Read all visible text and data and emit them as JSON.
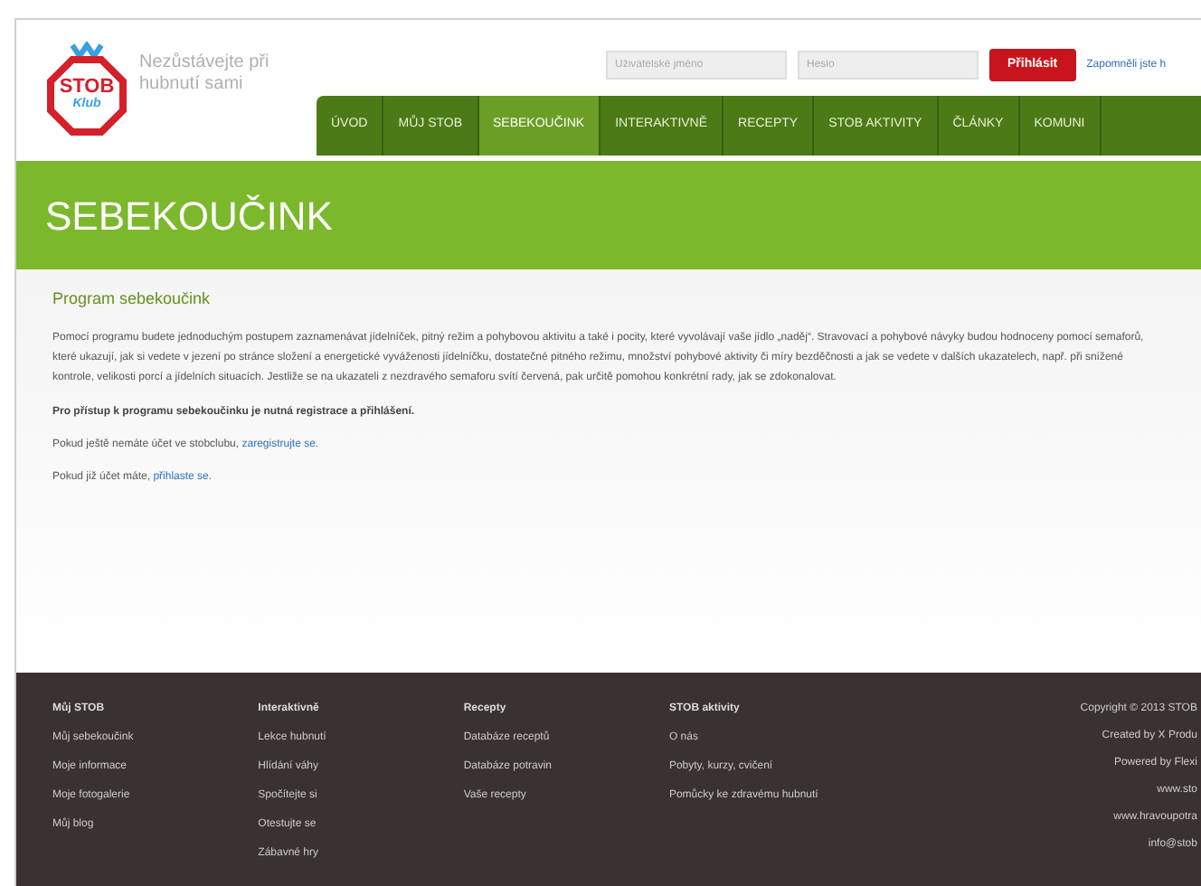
{
  "logo": {
    "top": "STOB",
    "bottom": "Klub"
  },
  "tagline": "Nezůstávejte při hubnutí sami",
  "login": {
    "username": {
      "placeholder": "Uživatelské jméno"
    },
    "password": {
      "placeholder": "Heslo"
    },
    "button": "Přihlásit",
    "forgot": "Zapomněli jste h"
  },
  "nav": [
    {
      "label": "ÚVOD",
      "selected": false
    },
    {
      "label": "MŮJ STOB",
      "selected": false
    },
    {
      "label": "SEBEKOUČINK",
      "selected": true
    },
    {
      "label": "INTERAKTIVNĚ",
      "selected": false
    },
    {
      "label": "RECEPTY",
      "selected": false
    },
    {
      "label": "STOB AKTIVITY",
      "selected": false
    },
    {
      "label": "ČLÁNKY",
      "selected": false
    },
    {
      "label": "KOMUNI",
      "selected": false
    }
  ],
  "page_title": "SEBEKOUČINK",
  "content": {
    "heading": "Program sebekoučink",
    "intro": "Pomocí programu budete jednoduchým postupem zaznamenávat jídelníček, pitný režim a pohybovou aktivitu a také i pocity, které vyvolávají vaše jídlo „naděj“. Stravovací a pohybové návyky budou hodnoceny pomocí semaforů, které ukazují, jak si vedete v jezení po stránce složení a energetické vyváženosti jídelníčku, dostatečné pitného režimu, množství pohybové aktivity či míry bezděčnosti a jak se vedete v dalších ukazatelech, např. při snížené kontrole, velikosti porcí a jídelních situacích. Jestliže se na ukazateli z nezdravého semaforu svítí červená, pak určitě pomohou konkrétní rady, jak se zdokonalovat.",
    "notice": "Pro přístup k programu sebekoučinku je nutná registrace a přihlášení.",
    "lines": [
      {
        "text": "Pokud ještě nemáte účet ve stobclubu, ",
        "link": "zaregistrujte se."
      },
      {
        "text": "Pokud již účet máte, ",
        "link": "přihlaste se."
      }
    ]
  },
  "footer": {
    "columns": [
      {
        "title": "Můj STOB",
        "items": [
          "Můj sebekoučink",
          "Moje informace",
          "Moje fotogalerie",
          "Můj blog"
        ]
      },
      {
        "title": "Interaktivně",
        "items": [
          "Lekce hubnutí",
          "Hlídání váhy",
          "Spočítejte si",
          "Otestujte se",
          "Zábavné hry"
        ]
      },
      {
        "title": "Recepty",
        "items": [
          "Databáze receptů",
          "Databáze potravin",
          "Vaše recepty"
        ]
      },
      {
        "title": "STOB aktivity",
        "items": [
          "O nás",
          "Pobyty, kurzy, cvičení",
          "Pomůcky ke zdravému hubnutí"
        ]
      }
    ],
    "credits": [
      "Copyright © 2013 STOB",
      "Created by X Produ",
      "Powered by Flexi",
      "www.sto",
      "www.hravoupotra",
      "info@stob"
    ]
  }
}
